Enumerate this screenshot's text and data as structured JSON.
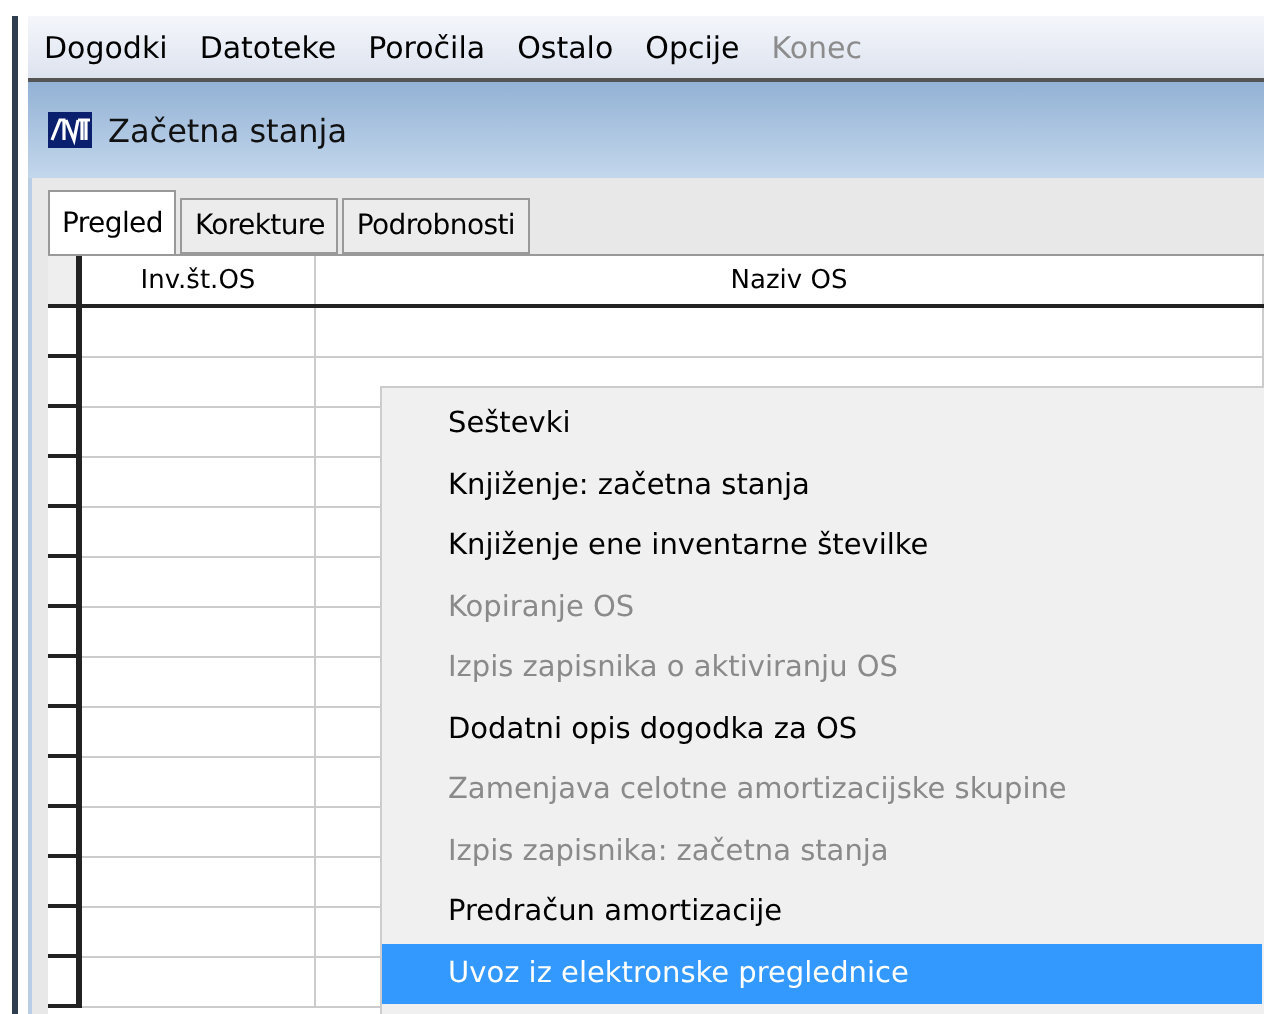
{
  "menu_bar": [
    {
      "label": "Dogodki",
      "disabled": false
    },
    {
      "label": "Datoteke",
      "disabled": false
    },
    {
      "label": "Poročila",
      "disabled": false
    },
    {
      "label": "Ostalo",
      "disabled": false
    },
    {
      "label": "Opcije",
      "disabled": false
    },
    {
      "label": "Konec",
      "disabled": true
    }
  ],
  "window": {
    "title": "Začetna stanja"
  },
  "tabs": [
    {
      "label": "Pregled",
      "selected": true
    },
    {
      "label": "Korekture",
      "selected": false
    },
    {
      "label": "Podrobnosti",
      "selected": false
    }
  ],
  "table": {
    "columns": [
      "Inv.št.OS",
      "Naziv OS"
    ]
  },
  "context_menu": [
    {
      "label": "Seštevki",
      "disabled": false,
      "selected": false
    },
    {
      "label": "Knjiženje: začetna stanja",
      "disabled": false,
      "selected": false
    },
    {
      "label": "Knjiženje ene inventarne številke",
      "disabled": false,
      "selected": false
    },
    {
      "label": "Kopiranje OS",
      "disabled": true,
      "selected": false
    },
    {
      "label": "Izpis zapisnika o aktiviranju OS",
      "disabled": true,
      "selected": false
    },
    {
      "label": "Dodatni opis dogodka za OS",
      "disabled": false,
      "selected": false
    },
    {
      "label": "Zamenjava celotne amortizacijske skupine",
      "disabled": true,
      "selected": false
    },
    {
      "label": "Izpis zapisnika: začetna stanja",
      "disabled": true,
      "selected": false
    },
    {
      "label": "Predračun amortizacije",
      "disabled": false,
      "selected": false
    },
    {
      "label": "Uvoz iz elektronske preglednice",
      "disabled": false,
      "selected": true
    }
  ]
}
